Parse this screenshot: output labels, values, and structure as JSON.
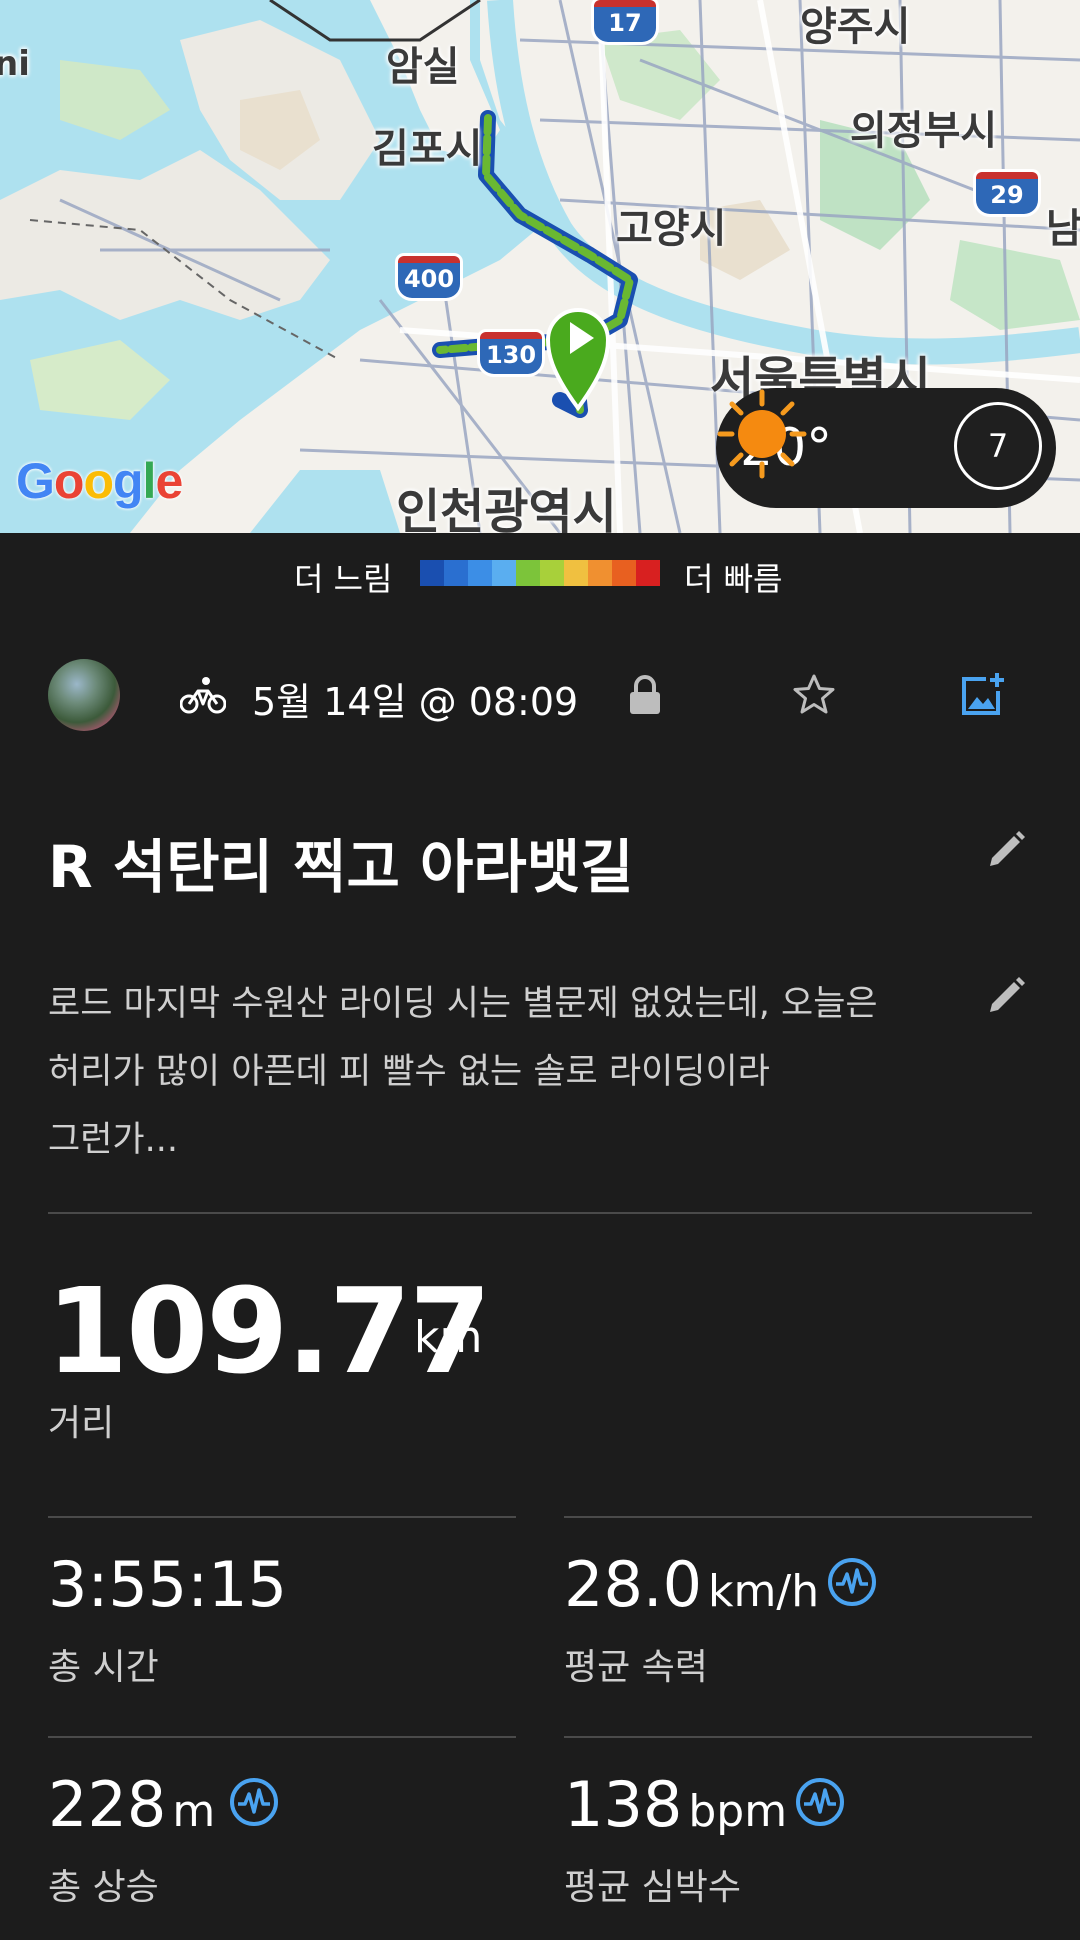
{
  "map": {
    "labels": {
      "amsil": "암실",
      "gimpo": "김포시",
      "goyang": "고양시",
      "uijeongbu": "의정부시",
      "yangju": "양주시",
      "seoul": "서울특별시",
      "incheon": "인천광역시",
      "nam": "남",
      "ni": "ni"
    },
    "shields": {
      "s17": "17",
      "s29": "29",
      "s400": "400",
      "s130": "130"
    },
    "attribution": "Google"
  },
  "weather": {
    "temperature": "20°",
    "wind": "7",
    "condition_icon": "sun-icon"
  },
  "legend": {
    "slow": "더 느림",
    "fast": "더 빠름",
    "colors": [
      "#1a4fb0",
      "#2a6fd0",
      "#3c8ee6",
      "#5aaef0",
      "#7cc43a",
      "#a8d03a",
      "#f0c040",
      "#f09030",
      "#e86020",
      "#d82020"
    ]
  },
  "activity": {
    "sport_icon": "bicycle-icon",
    "date": "5월 14일 @ 08:09",
    "privacy_icon": "lock-icon",
    "favorite_icon": "star-icon",
    "add_photo_icon": "add-photo-icon",
    "title": "R 석탄리 찍고 아라뱃길",
    "description_lines": [
      "로드 마지막 수원산 라이딩 시는 별문제 없었는데, 오늘은",
      "허리가 많이 아픈데 피 빨수 없는 솔로 라이딩이라",
      "그런가..."
    ]
  },
  "stats": {
    "distance": {
      "value": "109.77",
      "unit": "km",
      "label": "거리"
    },
    "time": {
      "value": "3:55:15",
      "unit": "",
      "label": "총 시간"
    },
    "speed": {
      "value": "28.0",
      "unit": "km/h",
      "label": "평균 속력"
    },
    "ascent": {
      "value": "228",
      "unit": "m",
      "label": "총 상승"
    },
    "heart_rate": {
      "value": "138",
      "unit": "bpm",
      "label": "평균 심박수"
    }
  },
  "colors": {
    "background": "#1c1c1c",
    "accent_blue": "#4aa3f0",
    "route_green": "#6ab832",
    "marker_green": "#4aaa1e"
  }
}
